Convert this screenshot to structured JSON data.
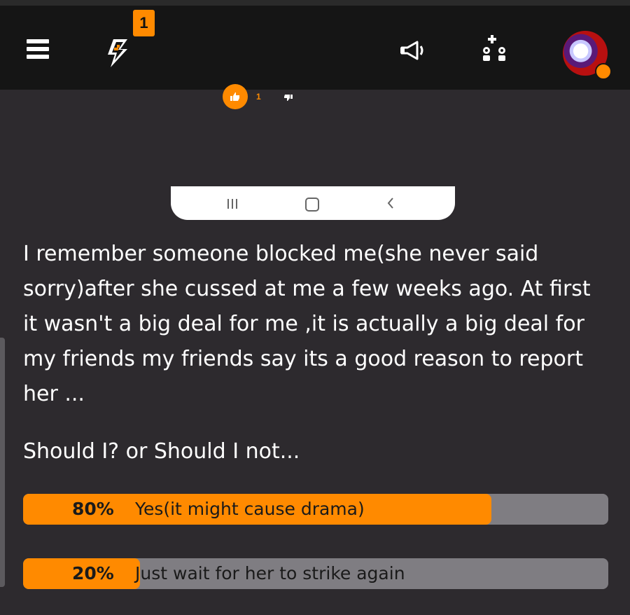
{
  "header": {
    "notification_count": "1"
  },
  "icons": {
    "menu": "hamburger-menu-icon",
    "alerts": "lightning-bolt-icon",
    "announcements": "megaphone-icon",
    "invite": "add-member-icon",
    "avatar": "user-avatar"
  },
  "votes": {
    "like_count": "1"
  },
  "post": {
    "body": "I remember someone blocked me(she never said sorry)after she cussed at me a few weeks ago. At first it wasn't a big deal for me ,it is actually a big deal for my friends my friends say its a good reason to report her ...",
    "question": "Should I? or Should I not..."
  },
  "poll": {
    "options": [
      {
        "percent_label": "80%",
        "percent": 80,
        "label": "Yes(it might cause drama)"
      },
      {
        "percent_label": "20%",
        "percent": 20,
        "label": "Just wait for her to strike again"
      }
    ]
  },
  "colors": {
    "accent": "#ff8a00",
    "background": "#2d2a2e",
    "topbar": "#151515",
    "poll_track": "#7f7d82"
  }
}
